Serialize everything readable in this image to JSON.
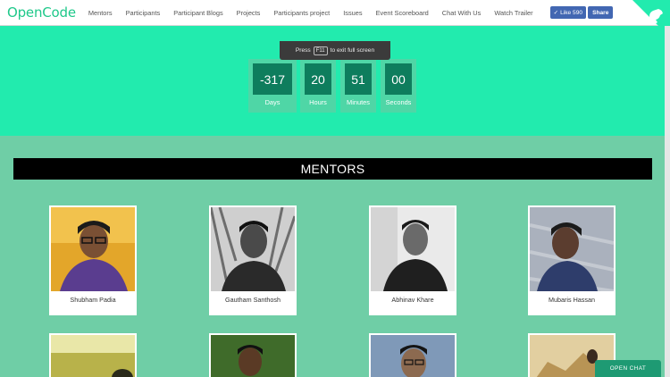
{
  "brand": {
    "logo": "OpenCode",
    "accent": "#1fc88a"
  },
  "nav": {
    "items": [
      "Mentors",
      "Participants",
      "Participant Blogs",
      "Projects",
      "Participants project",
      "Issues",
      "Event Scoreboard",
      "Chat With Us",
      "Watch Trailer"
    ],
    "fb_like": "Like 590",
    "fb_share": "Share"
  },
  "fullscreen_notice": {
    "before": "Press",
    "key": "F11",
    "after": "to exit full screen"
  },
  "countdown": [
    {
      "value": "-317",
      "label": "Days"
    },
    {
      "value": "20",
      "label": "Hours"
    },
    {
      "value": "51",
      "label": "Minutes"
    },
    {
      "value": "00",
      "label": "Seconds"
    }
  ],
  "section": {
    "title": "MENTORS"
  },
  "mentors": [
    {
      "name": "Shubham Padia"
    },
    {
      "name": "Gautham Santhosh"
    },
    {
      "name": "Abhinav Khare"
    },
    {
      "name": "Mubaris Hassan"
    }
  ],
  "chat": {
    "label": "OPEN CHAT"
  },
  "colors": {
    "hero": "#22ebae",
    "section": "#6fcea6",
    "countdown_box": "#0e7d5d",
    "bar": "#000000"
  }
}
